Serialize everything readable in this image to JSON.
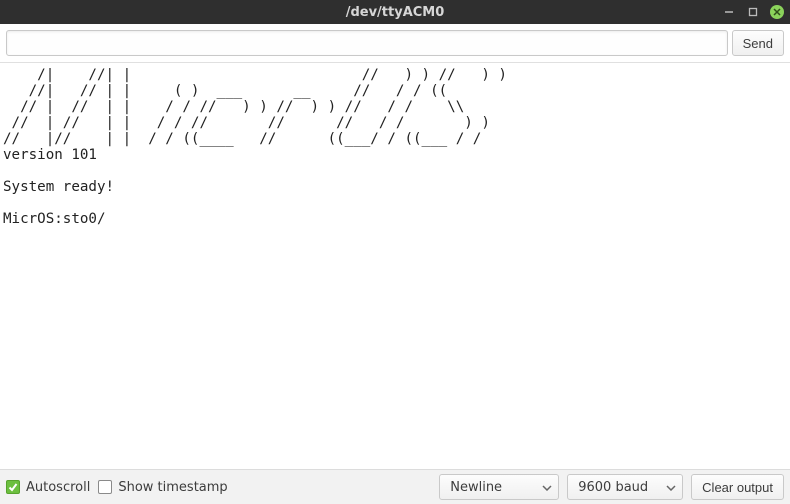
{
  "window": {
    "title": "/dev/ttyACM0"
  },
  "send": {
    "input_value": "",
    "button_label": "Send"
  },
  "console_output": "    /|    //| |                           //   ) ) //   ) )\n   //|   // | |     ( )  ___      __     //   / / ((\n  // |  //  | |    / / //   ) ) //  ) ) //   / /    \\\\\n //  | //   | |   / / //       //      //   / /       ) )\n//   |//    | |  / / ((____   //      ((___/ / ((___ / /\nversion 101\n\nSystem ready!\n\nMicrOS:sto0/\n",
  "options": {
    "autoscroll": {
      "checked": true,
      "label": "Autoscroll"
    },
    "show_timestamp": {
      "checked": false,
      "label": "Show timestamp"
    },
    "line_ending": {
      "selected": "Newline"
    },
    "baud": {
      "selected": "9600 baud"
    },
    "clear_button": "Clear output"
  }
}
